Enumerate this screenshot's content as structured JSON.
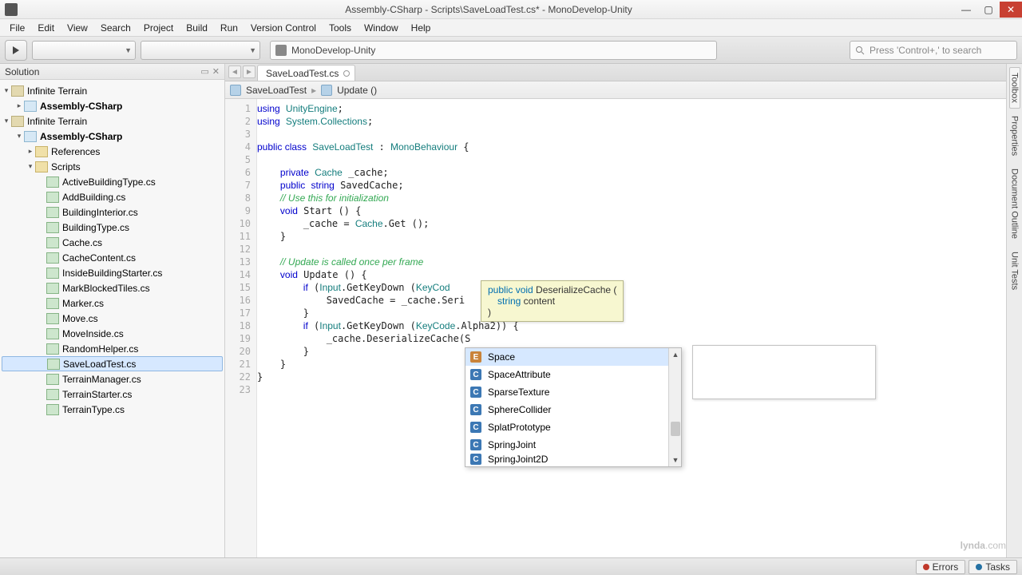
{
  "window": {
    "title": "Assembly-CSharp - Scripts\\SaveLoadTest.cs* - MonoDevelop-Unity"
  },
  "menu": [
    "File",
    "Edit",
    "View",
    "Search",
    "Project",
    "Build",
    "Run",
    "Version Control",
    "Tools",
    "Window",
    "Help"
  ],
  "toolbar": {
    "platform": "MonoDevelop-Unity",
    "search_placeholder": "Press 'Control+,' to search"
  },
  "solution": {
    "header": "Solution",
    "tree": {
      "sln1": "Infinite Terrain",
      "proj1": "Assembly-CSharp",
      "sln2": "Infinite Terrain",
      "proj2": "Assembly-CSharp",
      "refs": "References",
      "scripts": "Scripts",
      "files": [
        "ActiveBuildingType.cs",
        "AddBuilding.cs",
        "BuildingInterior.cs",
        "BuildingType.cs",
        "Cache.cs",
        "CacheContent.cs",
        "InsideBuildingStarter.cs",
        "MarkBlockedTiles.cs",
        "Marker.cs",
        "Move.cs",
        "MoveInside.cs",
        "RandomHelper.cs",
        "SaveLoadTest.cs",
        "TerrainManager.cs",
        "TerrainStarter.cs",
        "TerrainType.cs"
      ],
      "selected": "SaveLoadTest.cs"
    }
  },
  "editor": {
    "tab": "SaveLoadTest.cs",
    "breadcrumb": {
      "class": "SaveLoadTest",
      "method": "Update ()"
    },
    "lines": [
      {
        "n": 1,
        "h": "<span class='kw'>using</span> <span class='ty'>UnityEngine</span>;"
      },
      {
        "n": 2,
        "h": "<span class='kw'>using</span> <span class='ty'>System.Collections</span>;"
      },
      {
        "n": 3,
        "h": ""
      },
      {
        "n": 4,
        "h": "<span class='kw'>public class</span> <span class='ty'>SaveLoadTest</span> : <span class='ty'>MonoBehaviour</span> {"
      },
      {
        "n": 5,
        "h": ""
      },
      {
        "n": 6,
        "h": "    <span class='kw'>private</span> <span class='ty'>Cache</span> _cache;"
      },
      {
        "n": 7,
        "h": "    <span class='kw'>public</span> <span class='kw'>string</span> SavedCache;"
      },
      {
        "n": 8,
        "h": "    <span class='cm'>// Use this for initialization</span>"
      },
      {
        "n": 9,
        "h": "    <span class='kw'>void</span> Start () {"
      },
      {
        "n": 10,
        "h": "        _cache = <span class='ty'>Cache</span>.Get ();"
      },
      {
        "n": 11,
        "h": "    }"
      },
      {
        "n": 12,
        "h": ""
      },
      {
        "n": 13,
        "h": "    <span class='cm'>// Update is called once per frame</span>"
      },
      {
        "n": 14,
        "h": "    <span class='kw'>void</span> Update () {"
      },
      {
        "n": 15,
        "h": "        <span class='kw'>if</span> (<span class='ty'>Input</span>.GetKeyDown (<span class='ty'>KeyCod</span>"
      },
      {
        "n": 16,
        "h": "            SavedCache = _cache.Seri"
      },
      {
        "n": 17,
        "h": "        }"
      },
      {
        "n": 18,
        "h": "        <span class='kw'>if</span> (<span class='ty'>Input</span>.GetKeyDown (<span class='ty'>KeyCode</span>.Alpha2)) {"
      },
      {
        "n": 19,
        "h": "            _cache.DeserializeCache(S"
      },
      {
        "n": 20,
        "h": "        }"
      },
      {
        "n": 21,
        "h": "    }"
      },
      {
        "n": 22,
        "h": "}"
      },
      {
        "n": 23,
        "h": ""
      }
    ]
  },
  "signature": {
    "line1_pre": "public void",
    "line1_name": " DeserializeCache (",
    "line2_ty": "string",
    "line2_name": " content",
    "line3": ")"
  },
  "autocomplete": {
    "items": [
      {
        "k": "e",
        "t": "Space"
      },
      {
        "k": "c",
        "t": "SpaceAttribute"
      },
      {
        "k": "c",
        "t": "SparseTexture"
      },
      {
        "k": "c",
        "t": "SphereCollider"
      },
      {
        "k": "c",
        "t": "SplatPrototype"
      },
      {
        "k": "c",
        "t": "SpringJoint"
      },
      {
        "k": "c",
        "t": "SpringJoint2D"
      }
    ],
    "selected": 0
  },
  "right_tabs": [
    "Toolbox",
    "Properties",
    "Document Outline",
    "Unit Tests"
  ],
  "status": {
    "errors": "Errors",
    "tasks": "Tasks"
  },
  "watermark": {
    "a": "lynda",
    "b": ".com"
  }
}
